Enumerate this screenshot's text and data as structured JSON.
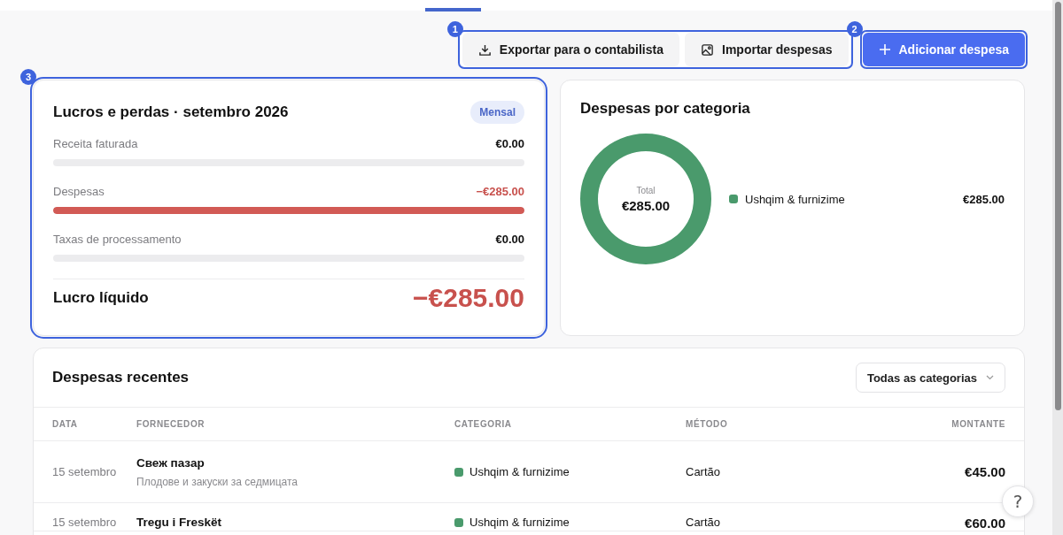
{
  "toolbar": {
    "annotation": "1",
    "buttons": [
      {
        "kind": "export",
        "label": "Exportar para o contabilista"
      },
      {
        "kind": "import",
        "label": "Importar despesas"
      }
    ]
  },
  "add_button": {
    "annotation": "2",
    "label": "Adicionar despesa"
  },
  "profit_loss": {
    "annotation": "3",
    "title": "Lucros e perdas · setembro 2026",
    "period_badge": "Mensal",
    "lines": [
      {
        "label": "Receita faturada",
        "amount": "€0.00",
        "negative": false,
        "level": 0
      },
      {
        "label": "Despesas",
        "amount": "−€285.00",
        "negative": true,
        "level": 1
      },
      {
        "label": "Taxas de processamento",
        "amount": "€0.00",
        "negative": false,
        "level": 0
      }
    ],
    "net_label": "Lucro líquido",
    "net_amount": "−€285.00",
    "net_negative": true
  },
  "category_card": {
    "title": "Despesas por categoria",
    "center_label": "Total",
    "center_value": "€285.00",
    "legend": [
      {
        "label": "Ushqim & furnizime",
        "amount": "€285.00",
        "color": "#4a9a6c"
      }
    ]
  },
  "recent": {
    "title": "Despesas recentes",
    "filter": "Todas as categorias",
    "columns": [
      "DATA",
      "FORNECEDOR",
      "CATEGORIA",
      "MÉTODO",
      "MONTANTE"
    ],
    "rows": [
      {
        "date": "15 setembro",
        "vendor": "Свеж пазар",
        "note": "Плодове и закуски за седмицата",
        "category": "Ushqim & furnizime",
        "color": "#4a9a6c",
        "method": "Cartão",
        "amount": "€45.00"
      },
      {
        "date": "15 setembro",
        "vendor": "Tregu i Freskët",
        "category": "Ushqim & furnizime",
        "color": "#4a9a6c",
        "method": "Cartão",
        "amount": "€60.00"
      }
    ]
  },
  "help_button": "?"
}
